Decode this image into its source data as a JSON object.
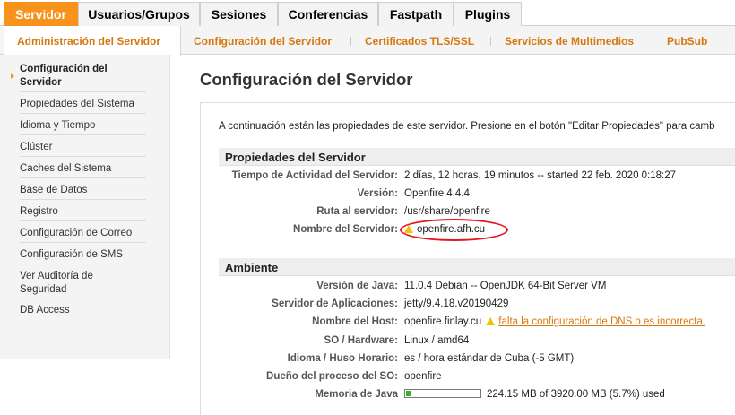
{
  "top_tabs": [
    {
      "label": "Servidor"
    },
    {
      "label": "Usuarios/Grupos"
    },
    {
      "label": "Sesiones"
    },
    {
      "label": "Conferencias"
    },
    {
      "label": "Fastpath"
    },
    {
      "label": "Plugins"
    }
  ],
  "sub_tabs": [
    {
      "label": "Administración del Servidor"
    },
    {
      "label": "Configuración del Servidor"
    },
    {
      "label": "Certificados TLS/SSL"
    },
    {
      "label": "Servicios de Multimedios"
    },
    {
      "label": "PubSub"
    }
  ],
  "sidebar": {
    "items": [
      {
        "label_line1": "Configuración del",
        "label_line2": "Servidor"
      },
      {
        "label": "Propiedades del Sistema"
      },
      {
        "label": "Idioma y Tiempo"
      },
      {
        "label": "Clúster"
      },
      {
        "label": "Caches del Sistema"
      },
      {
        "label": "Base de Datos"
      },
      {
        "label": "Registro"
      },
      {
        "label": "Configuración de Correo"
      },
      {
        "label": "Configuración de SMS"
      },
      {
        "label_line1": "Ver Auditoría de",
        "label_line2": "Seguridad"
      },
      {
        "label": "DB Access"
      }
    ]
  },
  "page": {
    "title": "Configuración del Servidor",
    "intro": "A continuación están las propiedades de este servidor. Presione en el botón \"Editar Propiedades\" para camb"
  },
  "server_properties": {
    "title": "Propiedades del Servidor",
    "rows": [
      {
        "label": "Tiempo de Actividad del Servidor:",
        "value": "2 días, 12 horas, 19 minutos -- started 22 feb. 2020 0:18:27"
      },
      {
        "label": "Versión:",
        "value": "Openfire 4.4.4"
      },
      {
        "label": "Ruta al servidor:",
        "value": "/usr/share/openfire"
      },
      {
        "label": "Nombre del Servidor:",
        "value": "openfire.afh.cu"
      }
    ]
  },
  "environment": {
    "title": "Ambiente",
    "rows": [
      {
        "label": "Versión de Java:",
        "value": "11.0.4 Debian -- OpenJDK 64-Bit Server VM"
      },
      {
        "label": "Servidor de Aplicaciones:",
        "value": "jetty/9.4.18.v20190429"
      },
      {
        "label": "Nombre del Host:",
        "value": "openfire.finlay.cu",
        "warning_link": "falta la configuración de DNS o es incorrecta."
      },
      {
        "label": "SO / Hardware:",
        "value": "Linux / amd64"
      },
      {
        "label": "Idioma / Huso Horario:",
        "value": "es / hora estándar de Cuba (-5 GMT)"
      },
      {
        "label": "Dueño del proceso del SO:",
        "value": "openfire"
      },
      {
        "label": "Memoria de Java",
        "value": "224.15 MB of 3920.00 MB (5.7%) used",
        "usage_percent": 5.7
      }
    ]
  },
  "colors": {
    "accent": "#f7931d",
    "link": "#d4790f",
    "annotation": "#e0181f",
    "memory_fill": "#3fae2b"
  },
  "icons": {
    "warning": "warning-icon",
    "active_arrow": "arrow-right-icon"
  }
}
